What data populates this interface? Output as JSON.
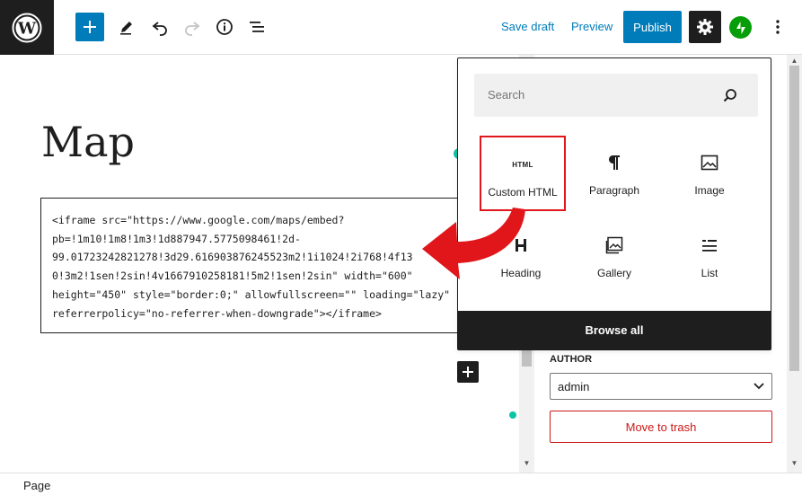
{
  "topbar": {
    "save_draft": "Save draft",
    "preview": "Preview",
    "publish": "Publish"
  },
  "editor": {
    "title": "Map",
    "code": "<iframe src=\"https://www.google.com/maps/embed?\npb=!1m10!1m8!1m3!1d887947.5775098461!2d-\n99.01723242821278!3d29.616903876245523m2!1i1024!2i768!4f13\n0!3m2!1sen!2sin!4v1667910258181!5m2!1sen!2sin\" width=\"600\"\nheight=\"450\" style=\"border:0;\" allowfullscreen=\"\" loading=\"lazy\"\nreferrerpolicy=\"no-referrer-when-downgrade\"></iframe>"
  },
  "inserter": {
    "search_placeholder": "Search",
    "blocks": [
      {
        "label": "Custom HTML",
        "icon": "html-icon",
        "icon_text": "HTML",
        "highlighted": true
      },
      {
        "label": "Paragraph",
        "icon": "paragraph-icon"
      },
      {
        "label": "Image",
        "icon": "image-icon"
      },
      {
        "label": "Heading",
        "icon": "heading-icon"
      },
      {
        "label": "Gallery",
        "icon": "gallery-icon"
      },
      {
        "label": "List",
        "icon": "list-icon"
      }
    ],
    "browse_all": "Browse all"
  },
  "sidebar": {
    "author_label": "AUTHOR",
    "author_value": "admin",
    "trash_label": "Move to trash"
  },
  "footer": {
    "breadcrumb": "Page"
  },
  "colors": {
    "accent": "#007cba",
    "dark": "#1e1e1e",
    "danger": "#cc1818",
    "annotation": "#e0161b",
    "jetpack": "#069e08"
  }
}
